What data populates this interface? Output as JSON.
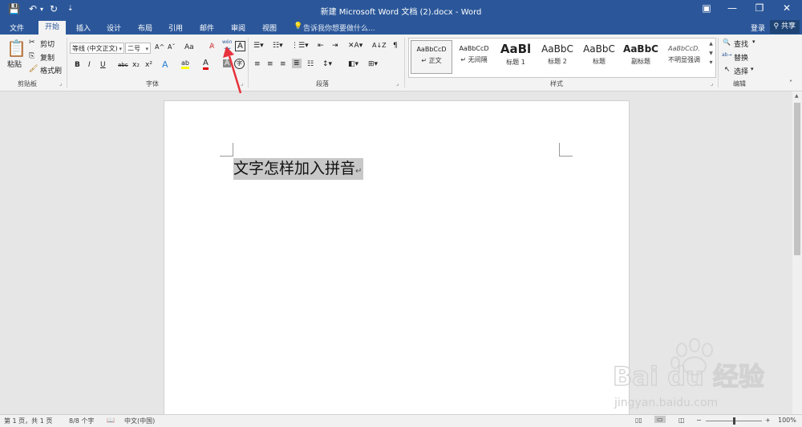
{
  "titlebar": {
    "title": "新建 Microsoft Word 文档 (2).docx - Word",
    "qat": {
      "save_icon": "💾",
      "undo_icon": "↶",
      "undo_dropdown": "▾",
      "redo_icon": "↻",
      "customize_icon": "⇣"
    },
    "window": {
      "ribbon_display_icon": "▣",
      "minimize_icon": "—",
      "restore_icon": "❐",
      "close_icon": "✕"
    }
  },
  "tabs": [
    {
      "label": "文件"
    },
    {
      "label": "开始"
    },
    {
      "label": "插入"
    },
    {
      "label": "设计"
    },
    {
      "label": "布局"
    },
    {
      "label": "引用"
    },
    {
      "label": "邮件"
    },
    {
      "label": "审阅"
    },
    {
      "label": "视图"
    }
  ],
  "tell_me": {
    "icon": "💡",
    "placeholder": "告诉我你想要做什么..."
  },
  "account": {
    "login": "登录",
    "share_icon": "⚲",
    "share": "共享"
  },
  "clipboard": {
    "paste": "粘贴",
    "cut": "剪切",
    "copy": "复制",
    "format_painter": "格式刷",
    "label": "剪贴板",
    "paste_icon": "📋",
    "cut_icon": "✂",
    "copy_icon": "⎘",
    "painter_icon": "🖌"
  },
  "font": {
    "font_name": "等线 (中文正文)",
    "font_size": "二号",
    "grow_icon": "A^",
    "shrink_icon": "Aˇ",
    "case_icon": "Aa",
    "clear_icon": "A̷",
    "phonetic_top": "wén",
    "phonetic_bottom": "文",
    "border_char": "A",
    "bold": "B",
    "italic": "I",
    "underline": "U",
    "strike": "abc",
    "sub": "x₂",
    "sup": "x²",
    "effects": "A",
    "highlight": "ab",
    "color": "A",
    "shade": "A",
    "circle": "字",
    "label": "字体"
  },
  "paragraph": {
    "label": "段落",
    "row1": [
      "☰▾",
      "☷▾",
      "⋮☰▾",
      "⇤",
      "⇥",
      "✕A▾",
      "A↓Z",
      "¶"
    ],
    "row2": [
      "≡",
      "≡",
      "≡",
      "≣",
      "☷",
      "↕▾",
      "◧▾",
      "⊞▾"
    ]
  },
  "styles": {
    "label": "样式",
    "items": [
      {
        "preview": "AaBbCcD",
        "name": "↵ 正文"
      },
      {
        "preview": "AaBbCcD",
        "name": "↵ 无间隔"
      },
      {
        "preview": "AaBl",
        "name": "标题 1"
      },
      {
        "preview": "AaBbC",
        "name": "标题 2"
      },
      {
        "preview": "AaBbC",
        "name": "标题"
      },
      {
        "preview": "AaBbC",
        "name": "副标题"
      },
      {
        "preview": "AaBbCcD.",
        "name": "不明显强调"
      }
    ],
    "scroll_up": "▲",
    "scroll_down": "▼",
    "more": "▾"
  },
  "editing": {
    "label": "编辑",
    "find": "查找",
    "replace": "替换",
    "select": "选择",
    "find_icon": "🔍",
    "replace_icon": "ab→",
    "select_icon": "↖"
  },
  "document": {
    "text": "文字怎样加入拼音",
    "para_mark": "↵"
  },
  "status": {
    "page": "第 1 页，共 1 页",
    "words": "8/8 个字",
    "proof_icon": "📖",
    "language": "中文(中国)",
    "zoom": "100%",
    "zoom_minus": "−",
    "zoom_plus": "+",
    "zoom_level": 1.0
  },
  "watermark": {
    "brand": "Bai du 经验",
    "url": "jingyan.baidu.com"
  },
  "colors": {
    "accent": "#2b579a",
    "arrow": "#e8323c",
    "selection": "#c8c8c8",
    "font_color_bar": "#e00000",
    "highlight_bar": "#ffff00"
  }
}
